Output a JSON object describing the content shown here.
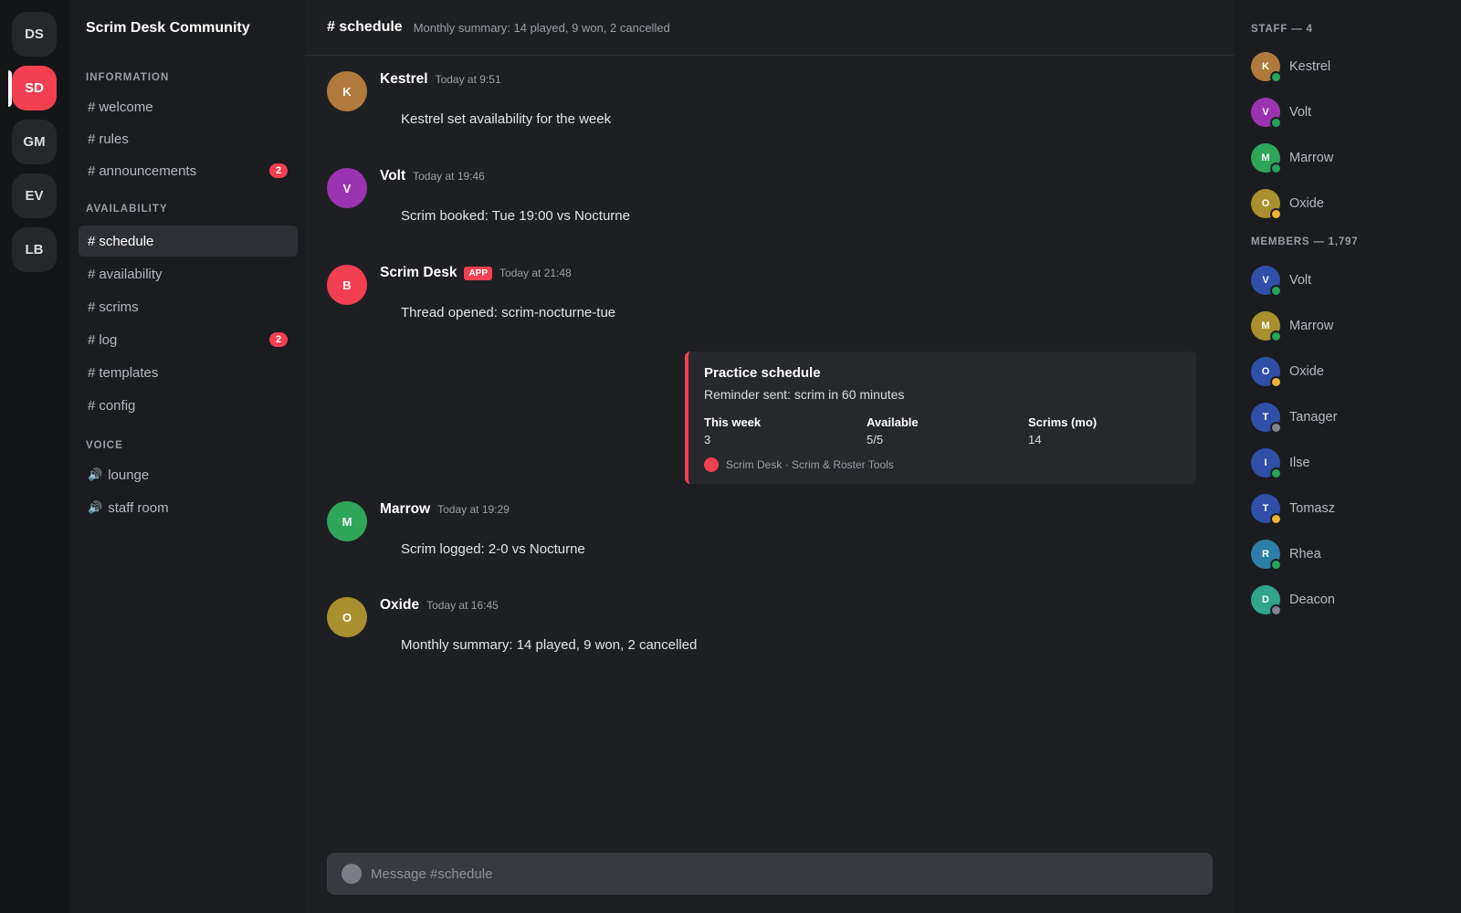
{
  "servers": [
    {
      "label": "DS",
      "active": false
    },
    {
      "label": "SD",
      "active": true
    },
    {
      "label": "GM",
      "active": false
    },
    {
      "label": "EV",
      "active": false
    },
    {
      "label": "LB",
      "active": false
    }
  ],
  "guild": {
    "name": "Scrim Desk Community"
  },
  "categories": {
    "information": "INFORMATION",
    "availability": "AVAILABILITY",
    "voice": "VOICE"
  },
  "channels": {
    "welcome": {
      "label": "welcome"
    },
    "rules": {
      "label": "rules"
    },
    "announcements": {
      "label": "announcements",
      "badge": "2"
    },
    "schedule": {
      "label": "schedule"
    },
    "availability": {
      "label": "availability"
    },
    "scrims": {
      "label": "scrims"
    },
    "log": {
      "label": "log",
      "badge": "2"
    },
    "templates": {
      "label": "templates"
    },
    "config": {
      "label": "config"
    },
    "lounge": {
      "label": "lounge"
    },
    "staff_room": {
      "label": "staff room"
    }
  },
  "header": {
    "channel": "# schedule",
    "topic": "Monthly summary: 14 played, 9 won, 2 cancelled"
  },
  "messages": [
    {
      "initial": "K",
      "author": "Kestrel",
      "time": "Today at 9:51",
      "text": "Kestrel set availability for the week",
      "color": "#b07a3c"
    },
    {
      "initial": "V",
      "author": "Volt",
      "time": "Today at 19:46",
      "text": "Scrim booked: Tue 19:00 vs Nocturne",
      "color": "#9b33b0"
    },
    {
      "initial": "B",
      "author": "Scrim Desk",
      "tag": "APP",
      "time": "Today at 21:48",
      "text": "Thread opened: scrim-nocturne-tue",
      "color": "#f23f52"
    },
    {
      "initial": "M",
      "author": "Marrow",
      "time": "Today at 19:29",
      "text": "Scrim logged: 2-0 vs Nocturne",
      "color": "#2fa55a"
    },
    {
      "initial": "O",
      "author": "Oxide",
      "time": "Today at 16:45",
      "text": "Monthly summary: 14 played, 9 won, 2 cancelled",
      "color": "#a8902e"
    }
  ],
  "embed": {
    "title": "Practice schedule",
    "description": "Reminder sent: scrim in 60 minutes",
    "fields": [
      {
        "name": "This week",
        "value": "3"
      },
      {
        "name": "Available",
        "value": "5/5"
      },
      {
        "name": "Scrims (mo)",
        "value": "14"
      }
    ],
    "footer": "Scrim Desk · Scrim & Roster Tools",
    "accent": "#f23f52"
  },
  "composer": {
    "placeholder": "Message #schedule"
  },
  "members": {
    "staff_title": "STAFF — 4",
    "staff": [
      {
        "initial": "K",
        "name": "Kestrel",
        "color": "#b07a3c",
        "status": "online"
      },
      {
        "initial": "V",
        "name": "Volt",
        "color": "#9b33b0",
        "status": "online"
      },
      {
        "initial": "M",
        "name": "Marrow",
        "color": "#2fa55a",
        "status": "online"
      },
      {
        "initial": "O",
        "name": "Oxide",
        "color": "#a8902e",
        "status": "idle"
      }
    ],
    "members_title": "MEMBERS — 1,797",
    "list": [
      {
        "initial": "V",
        "name": "Volt",
        "color": "#2f4fa8",
        "status": "online"
      },
      {
        "initial": "M",
        "name": "Marrow",
        "color": "#a8902e",
        "status": "online"
      },
      {
        "initial": "O",
        "name": "Oxide",
        "color": "#2f4fa8",
        "status": "idle"
      },
      {
        "initial": "T",
        "name": "Tanager",
        "color": "#2f4fa8",
        "status": "offline"
      },
      {
        "initial": "I",
        "name": "Ilse",
        "color": "#2f4fa8",
        "status": "online"
      },
      {
        "initial": "T",
        "name": "Tomasz",
        "color": "#2f4fa8",
        "status": "idle"
      },
      {
        "initial": "R",
        "name": "Rhea",
        "color": "#2e7fa8",
        "status": "online"
      },
      {
        "initial": "D",
        "name": "Deacon",
        "color": "#2fa58a",
        "status": "offline"
      }
    ]
  },
  "status_colors": {
    "online": "#23a55a",
    "idle": "#f0b232",
    "offline": "#80848e"
  }
}
